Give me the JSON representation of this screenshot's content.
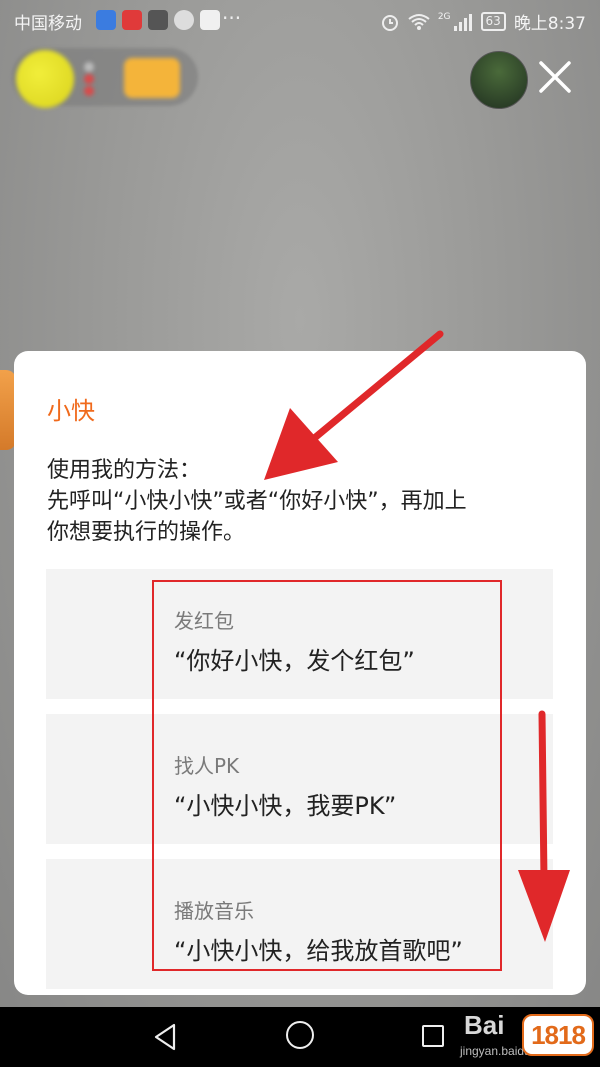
{
  "status_bar": {
    "carrier": "中国移动",
    "signal_type": "2G",
    "battery": "63",
    "time": "晚上8:37"
  },
  "watermark": {
    "baidu": "Bai",
    "url": "jingyan.baidu.com",
    "logo": "1818"
  },
  "dialog": {
    "title": "小快",
    "instructions": [
      "使用我的方法：",
      "先呼叫“小快小快”或者“你好小快”，再加上",
      "你想要执行的操作。"
    ],
    "commands": [
      {
        "label": "发红包",
        "phrase": "“你好小快，发个红包”"
      },
      {
        "label": "找人PK",
        "phrase": "“小快小快，我要PK”"
      },
      {
        "label": "播放音乐",
        "phrase": "“小快小快，给我放首歌吧”"
      }
    ]
  },
  "colors": {
    "accent": "#f06a1c",
    "annotation_red": "#e0282a",
    "card_bg": "#f3f3f3",
    "backdrop": "#9a9a98"
  },
  "icons": [
    "close-icon",
    "back-icon",
    "home-icon",
    "recent-apps-icon",
    "alarm-icon",
    "wifi-icon",
    "signal-icon",
    "battery-icon"
  ]
}
